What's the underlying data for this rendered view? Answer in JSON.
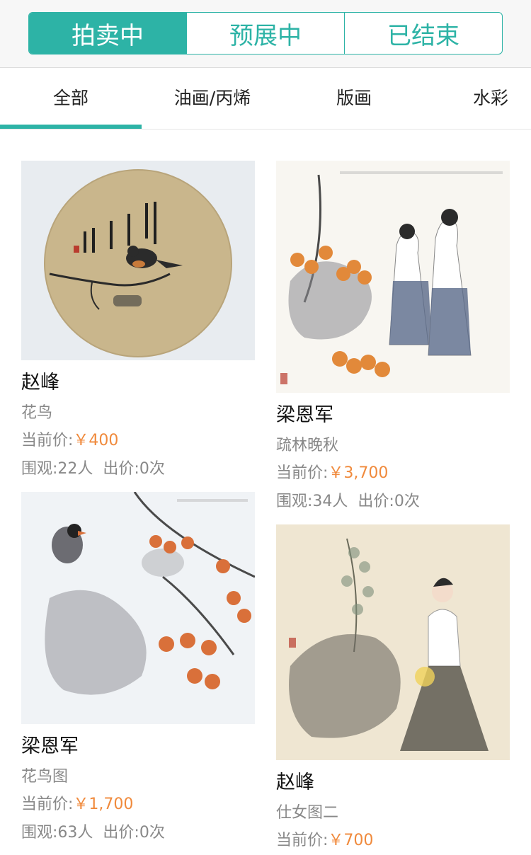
{
  "status_tabs": [
    "拍卖中",
    "预展中",
    "已结束"
  ],
  "categories": [
    "全部",
    "油画/丙烯",
    "版画",
    "水彩"
  ],
  "labels": {
    "price_prefix": "当前价:",
    "views_prefix": "围观:",
    "bids_prefix": "出价:"
  },
  "items": [
    {
      "artist": "赵峰",
      "title": "花鸟",
      "price": "￥400",
      "views": "22人",
      "bids": "0次"
    },
    {
      "artist": "梁恩军",
      "title": "疏林晚秋",
      "price": "￥3,700",
      "views": "34人",
      "bids": "0次"
    },
    {
      "artist": "梁恩军",
      "title": "花鸟图",
      "price": "￥1,700",
      "views": "63人",
      "bids": "0次"
    },
    {
      "artist": "赵峰",
      "title": "仕女图二",
      "price": "￥700"
    }
  ],
  "colors": {
    "accent": "#2db3a6",
    "price": "#f08a3c",
    "muted": "#888888"
  }
}
